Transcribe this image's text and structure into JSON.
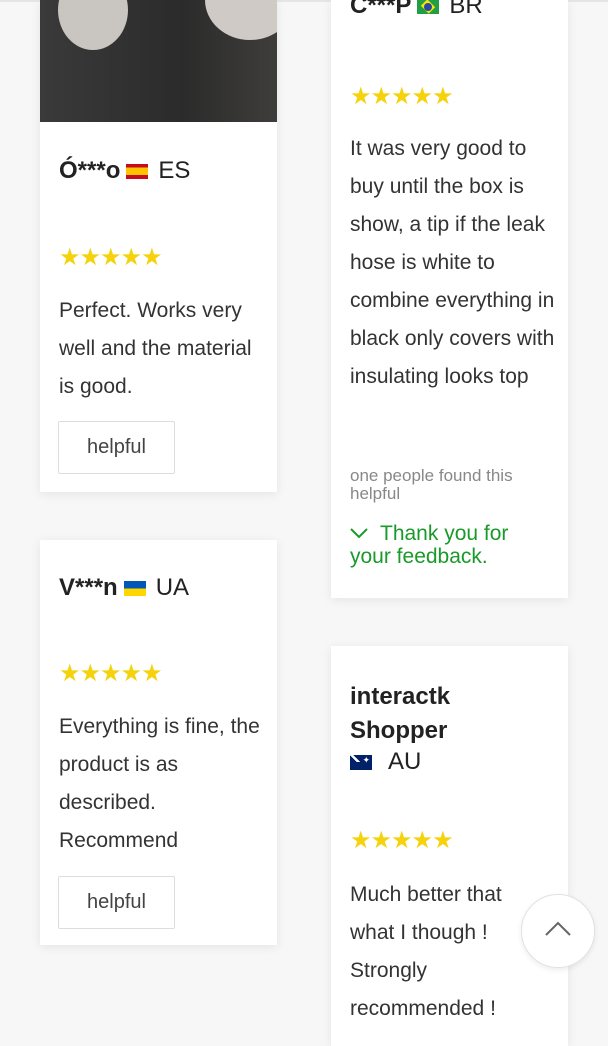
{
  "reviews": [
    {
      "name": "Ó***o",
      "country": "ES",
      "flag_icon": "spain-flag-icon",
      "stars": "★★★★★",
      "text": "Perfect. Works very well and the material is good.",
      "helpful_label": "helpful"
    },
    {
      "name": "V***n",
      "country": "UA",
      "flag_icon": "ukraine-flag-icon",
      "stars": "★★★★★",
      "text": "Everything is fine, the product is as described. Recommend",
      "helpful_label": "helpful"
    },
    {
      "name": "C***P",
      "country": "BR",
      "flag_icon": "brazil-flag-icon",
      "stars": "★★★★★",
      "text": "It was very good to buy until the box is show, a tip if the leak hose is white to combine everything in black only covers with insulating looks top",
      "found_helpful": "one people found this helpful",
      "thanks": "Thank you for your feedback."
    },
    {
      "name": "interactk Shopper",
      "country": "AU",
      "flag_icon": "australia-flag-icon",
      "stars": "★★★★★",
      "text": "Much better that what I though ! Strongly recommended !"
    }
  ],
  "colors": {
    "star": "#f5d20c",
    "thanks": "#1a9a2a"
  },
  "scroll_top_icon": "chevron-up-icon"
}
